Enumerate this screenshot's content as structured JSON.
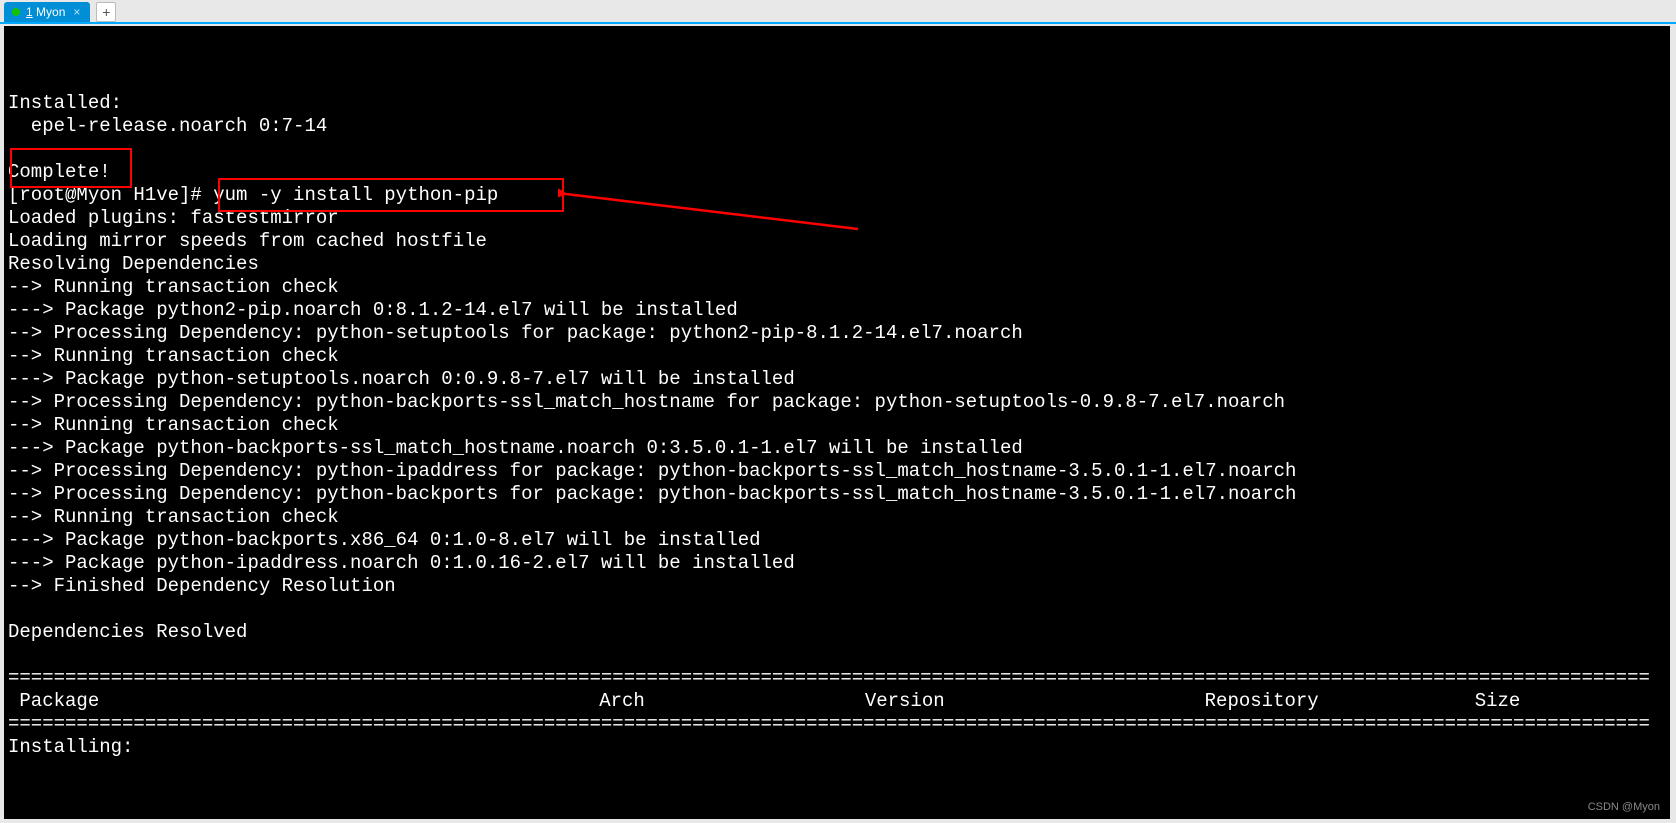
{
  "tab": {
    "dot_color": "#13c200",
    "number": "1",
    "title": "Myon",
    "close": "×",
    "add": "+"
  },
  "terminal": {
    "lines": [
      "",
      "Installed:",
      "  epel-release.noarch 0:7-14",
      "",
      "Complete!",
      "[root@Myon H1ve]# yum -y install python-pip",
      "Loaded plugins: fastestmirror",
      "Loading mirror speeds from cached hostfile",
      "Resolving Dependencies",
      "--> Running transaction check",
      "---> Package python2-pip.noarch 0:8.1.2-14.el7 will be installed",
      "--> Processing Dependency: python-setuptools for package: python2-pip-8.1.2-14.el7.noarch",
      "--> Running transaction check",
      "---> Package python-setuptools.noarch 0:0.9.8-7.el7 will be installed",
      "--> Processing Dependency: python-backports-ssl_match_hostname for package: python-setuptools-0.9.8-7.el7.noarch",
      "--> Running transaction check",
      "---> Package python-backports-ssl_match_hostname.noarch 0:3.5.0.1-1.el7 will be installed",
      "--> Processing Dependency: python-ipaddress for package: python-backports-ssl_match_hostname-3.5.0.1-1.el7.noarch",
      "--> Processing Dependency: python-backports for package: python-backports-ssl_match_hostname-3.5.0.1-1.el7.noarch",
      "--> Running transaction check",
      "---> Package python-backports.x86_64 0:1.0-8.el7 will be installed",
      "---> Package python-ipaddress.noarch 0:1.0.16-2.el7 will be installed",
      "--> Finished Dependency Resolution",
      "",
      "Dependencies Resolved",
      ""
    ],
    "rule": "================================================================================================================================================",
    "header": {
      "package": " Package",
      "arch": "Arch",
      "version": "Version",
      "repository": "Repository",
      "size": "Size"
    },
    "installing": "Installing:"
  },
  "annotations": {
    "highlight1": "Complete!",
    "highlight2": "yum -y install python-pip",
    "arrow_color": "#ff0000"
  },
  "watermark": "CSDN @Myon⁣"
}
